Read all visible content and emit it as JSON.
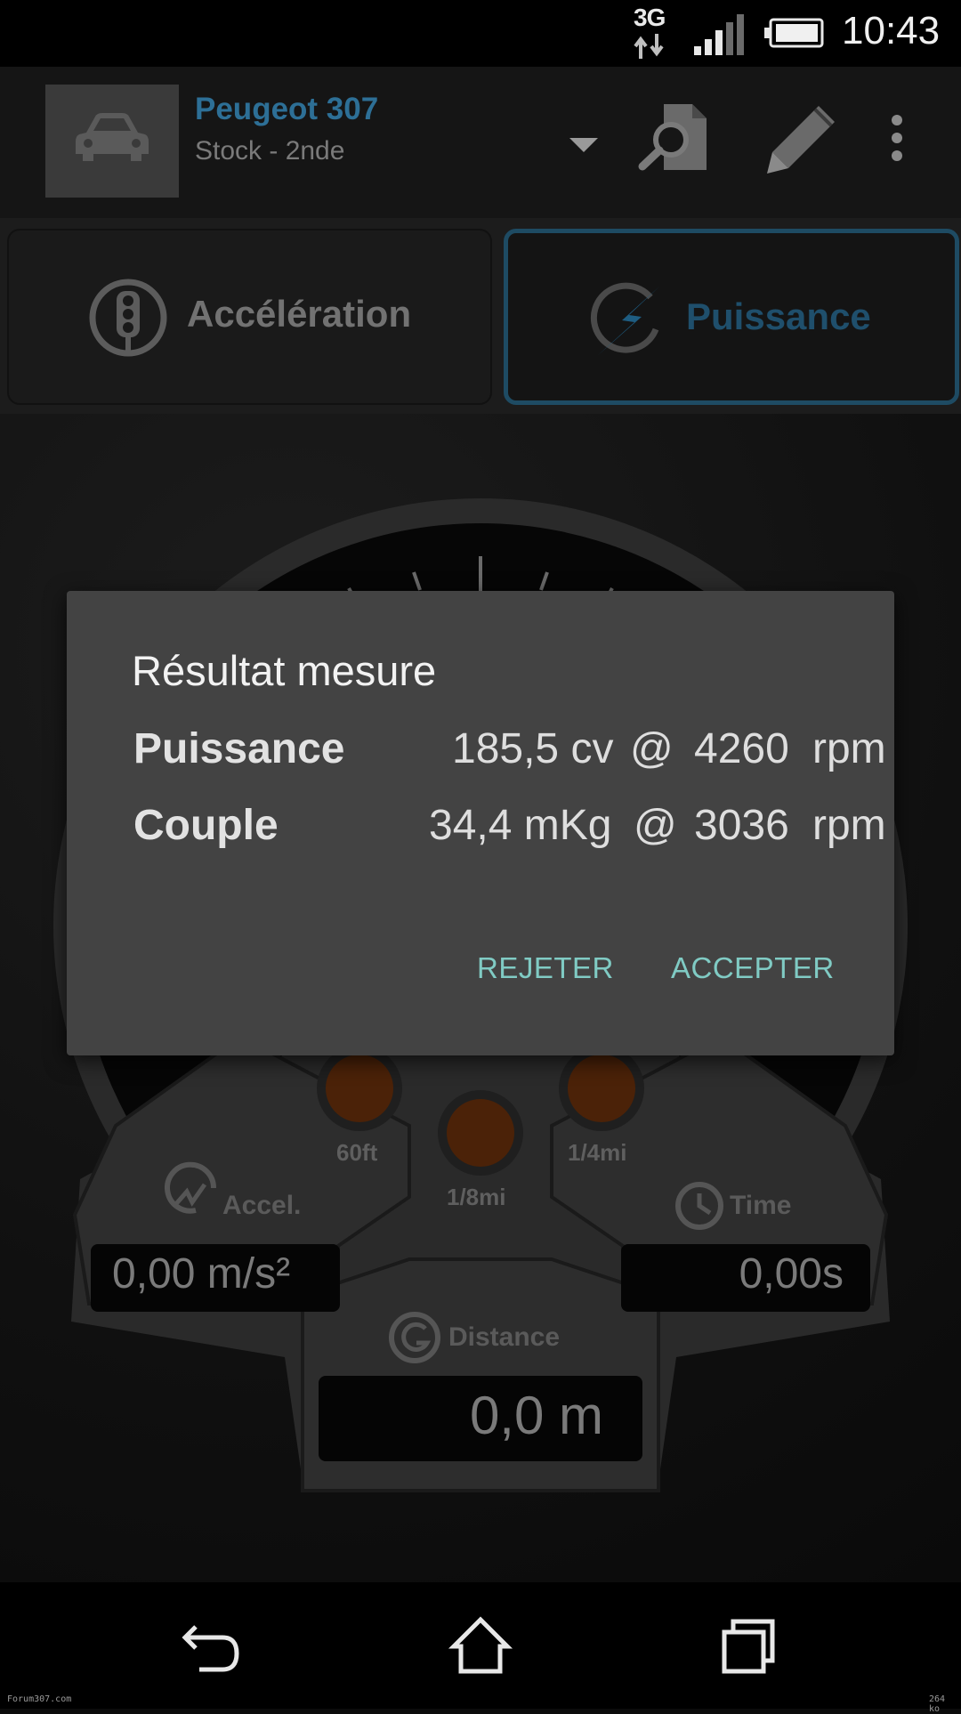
{
  "status_bar": {
    "network": "3G",
    "time": "10:43",
    "icons": [
      "data-arrows-icon",
      "signal-icon",
      "battery-icon"
    ]
  },
  "toolbar": {
    "car_name": "Peugeot 307",
    "car_config": "Stock - 2nde",
    "icons": [
      "car-icon",
      "dropdown-arrow-icon",
      "search-document-icon",
      "pencil-icon",
      "overflow-menu-icon"
    ]
  },
  "tabs": [
    {
      "label": "Accélération",
      "icon": "traffic-light-icon",
      "active": false
    },
    {
      "label": "Puissance",
      "icon": "lightning-icon",
      "active": true
    }
  ],
  "gauge": {
    "lights": [
      "60ft",
      "1/8mi",
      "1/4mi"
    ],
    "accel": {
      "label": "Accel.",
      "value": "0,00 m/s²"
    },
    "time": {
      "label": "Time",
      "value": "0,00s"
    },
    "distance": {
      "label": "Distance",
      "value": "0,0 m"
    }
  },
  "dialog": {
    "title": "Résultat mesure",
    "rows": [
      {
        "label": "Puissance",
        "value": "185,5 cv",
        "at": "@",
        "rpm": "4260",
        "unit": "rpm"
      },
      {
        "label": "Couple",
        "value": "34,4 mKg",
        "at": "@",
        "rpm": "3036",
        "unit": "rpm"
      }
    ],
    "reject": "REJETER",
    "accept": "ACCEPTER"
  },
  "footer": {
    "left": "Forum307.com",
    "right": "264 ko"
  },
  "colors": {
    "accent": "#2d6f96",
    "dialog_bg": "#434343",
    "button_text": "#80cbc4",
    "light_off": "#5a2a0c"
  }
}
